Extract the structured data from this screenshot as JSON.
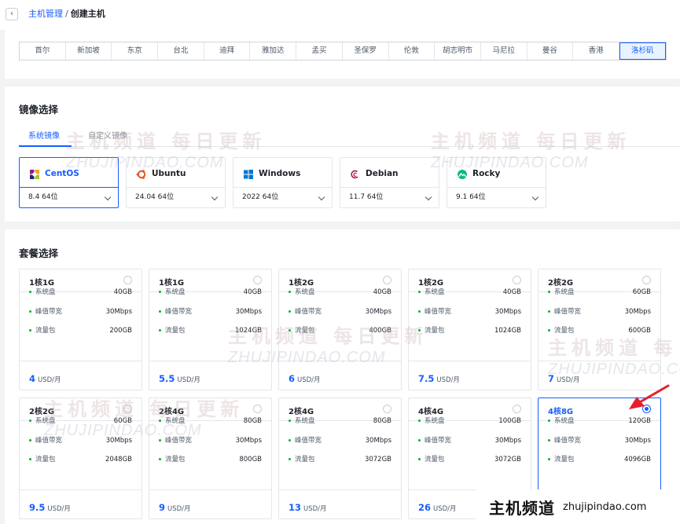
{
  "breadcrumb": {
    "parent": "主机管理",
    "separator": "/",
    "current": "创建主机"
  },
  "regions": {
    "selected": "洛杉矶",
    "items": [
      "首尔",
      "新加坡",
      "东京",
      "台北",
      "迪拜",
      "雅加达",
      "孟买",
      "圣保罗",
      "伦敦",
      "胡志明市",
      "马尼拉",
      "曼谷",
      "香港",
      "洛杉矶"
    ]
  },
  "image_section": {
    "title": "镜像选择",
    "tabs": [
      {
        "label": "系统镜像",
        "active": true
      },
      {
        "label": "自定义镜像",
        "active": false
      }
    ],
    "os_list": [
      {
        "name": "CentOS",
        "version": "8.4 64位",
        "icon": "centos-icon",
        "selected": true
      },
      {
        "name": "Ubuntu",
        "version": "24.04 64位",
        "icon": "ubuntu-icon",
        "selected": false
      },
      {
        "name": "Windows",
        "version": "2022 64位",
        "icon": "windows-icon",
        "selected": false
      },
      {
        "name": "Debian",
        "version": "11.7 64位",
        "icon": "debian-icon",
        "selected": false
      },
      {
        "name": "Rocky",
        "version": "9.1 64位",
        "icon": "rocky-icon",
        "selected": false
      }
    ]
  },
  "plan_section": {
    "title": "套餐选择",
    "spec_labels": {
      "disk": "系统盘",
      "bandwidth": "峰值带宽",
      "traffic": "流量包"
    },
    "price_unit": "USD/月",
    "plans": [
      {
        "name": "1核1G",
        "disk": "40GB",
        "bandwidth": "30Mbps",
        "traffic": "200GB",
        "price": "4",
        "selected": false
      },
      {
        "name": "1核1G",
        "disk": "40GB",
        "bandwidth": "30Mbps",
        "traffic": "1024GB",
        "price": "5.5",
        "selected": false
      },
      {
        "name": "1核2G",
        "disk": "40GB",
        "bandwidth": "30Mbps",
        "traffic": "400GB",
        "price": "6",
        "selected": false
      },
      {
        "name": "1核2G",
        "disk": "40GB",
        "bandwidth": "30Mbps",
        "traffic": "1024GB",
        "price": "7.5",
        "selected": false
      },
      {
        "name": "2核2G",
        "disk": "60GB",
        "bandwidth": "30Mbps",
        "traffic": "600GB",
        "price": "7",
        "selected": false
      },
      {
        "name": "2核2G",
        "disk": "60GB",
        "bandwidth": "30Mbps",
        "traffic": "2048GB",
        "price": "9.5",
        "selected": false
      },
      {
        "name": "2核4G",
        "disk": "80GB",
        "bandwidth": "30Mbps",
        "traffic": "800GB",
        "price": "9",
        "selected": false
      },
      {
        "name": "2核4G",
        "disk": "80GB",
        "bandwidth": "30Mbps",
        "traffic": "3072GB",
        "price": "13",
        "selected": false
      },
      {
        "name": "4核4G",
        "disk": "100GB",
        "bandwidth": "30Mbps",
        "traffic": "3072GB",
        "price": "26",
        "selected": false
      },
      {
        "name": "4核8G",
        "disk": "120GB",
        "bandwidth": "30Mbps",
        "traffic": "4096GB",
        "price": "",
        "selected": true
      }
    ]
  },
  "watermark": {
    "cn": "主机频道 每日更新",
    "en": "ZHUJIPINDAO.COM"
  },
  "banner": {
    "cn": "主机频道",
    "en": "zhujipindao.com"
  },
  "colors": {
    "accent": "#165dff",
    "dot": "#00b42a",
    "arrow": "#e5202b"
  }
}
